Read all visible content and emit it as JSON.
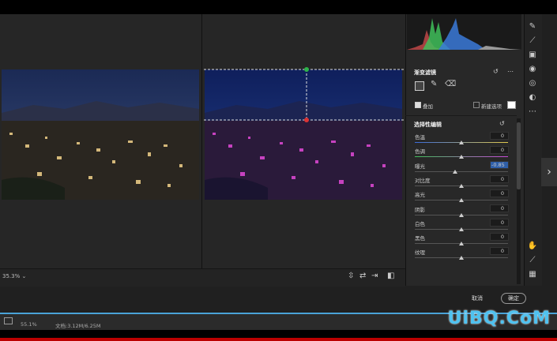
{
  "zoom": {
    "label": "35.3%"
  },
  "panel": {
    "graduated_filter_title": "渐变滤镜",
    "overlay_label": "叠加",
    "new_option_label": "新建选项",
    "selective_edit_title": "选择性编辑",
    "sliders": [
      {
        "label": "色温",
        "value": "0",
        "level": 0.5
      },
      {
        "label": "色调",
        "value": "0",
        "level": 0.5
      },
      {
        "label": "曝光",
        "value": "-0.85",
        "level": 0.43
      },
      {
        "label": "对比度",
        "value": "0",
        "level": 0.5
      },
      {
        "label": "高光",
        "value": "0",
        "level": 0.5
      },
      {
        "label": "阴影",
        "value": "0",
        "level": 0.5
      },
      {
        "label": "白色",
        "value": "0",
        "level": 0.5
      },
      {
        "label": "黑色",
        "value": "0",
        "level": 0.5
      },
      {
        "label": "纹理",
        "value": "0",
        "level": 0.5
      }
    ]
  },
  "footer": {
    "cancel": "取消",
    "ok": "确定"
  },
  "status": {
    "zoom": "55.1%",
    "doc": "文档:3.12M/6.25M"
  },
  "watermark": "UiBQ.CoM",
  "colors": {
    "accent": "#4aa3d8",
    "watermark": "#4fc2f0",
    "handle_green": "#2db34a",
    "handle_red": "#d33"
  }
}
